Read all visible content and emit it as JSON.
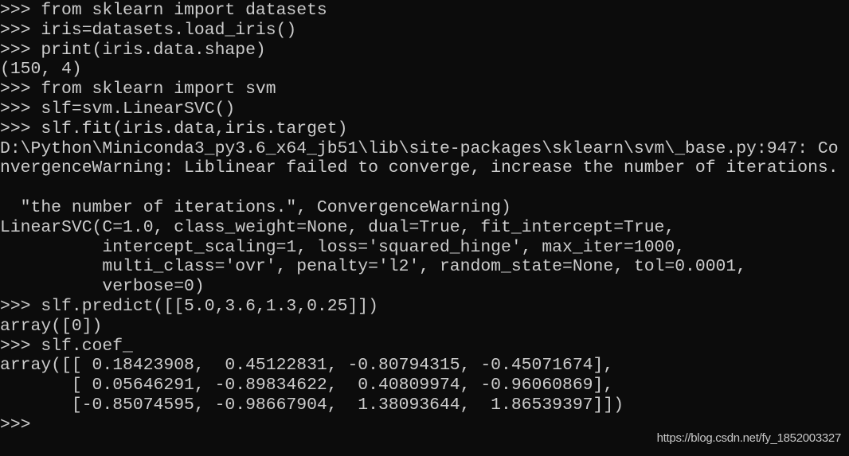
{
  "console": {
    "lines": [
      ">>> from sklearn import datasets",
      ">>> iris=datasets.load_iris()",
      ">>> print(iris.data.shape)",
      "(150, 4)",
      ">>> from sklearn import svm",
      ">>> slf=svm.LinearSVC()",
      ">>> slf.fit(iris.data,iris.target)",
      "D:\\Python\\Miniconda3_py3.6_x64_jb51\\lib\\site-packages\\sklearn\\svm\\_base.py:947: Co",
      "nvergenceWarning: Liblinear failed to converge, increase the number of iterations.",
      "",
      "  \"the number of iterations.\", ConvergenceWarning)",
      "LinearSVC(C=1.0, class_weight=None, dual=True, fit_intercept=True,",
      "          intercept_scaling=1, loss='squared_hinge', max_iter=1000,",
      "          multi_class='ovr', penalty='l2', random_state=None, tol=0.0001,",
      "          verbose=0)",
      ">>> slf.predict([[5.0,3.6,1.3,0.25]])",
      "array([0])",
      ">>> slf.coef_",
      "array([[ 0.18423908,  0.45122831, -0.80794315, -0.45071674],",
      "       [ 0.05646291, -0.89834622,  0.40809974, -0.96060869],",
      "       [-0.85074595, -0.98667904,  1.38093644,  1.86539397]])",
      ">>>"
    ]
  },
  "watermark": "https://blog.csdn.net/fy_1852003327",
  "colors": {
    "background": "#0c0c0c",
    "text": "#cccccc"
  }
}
